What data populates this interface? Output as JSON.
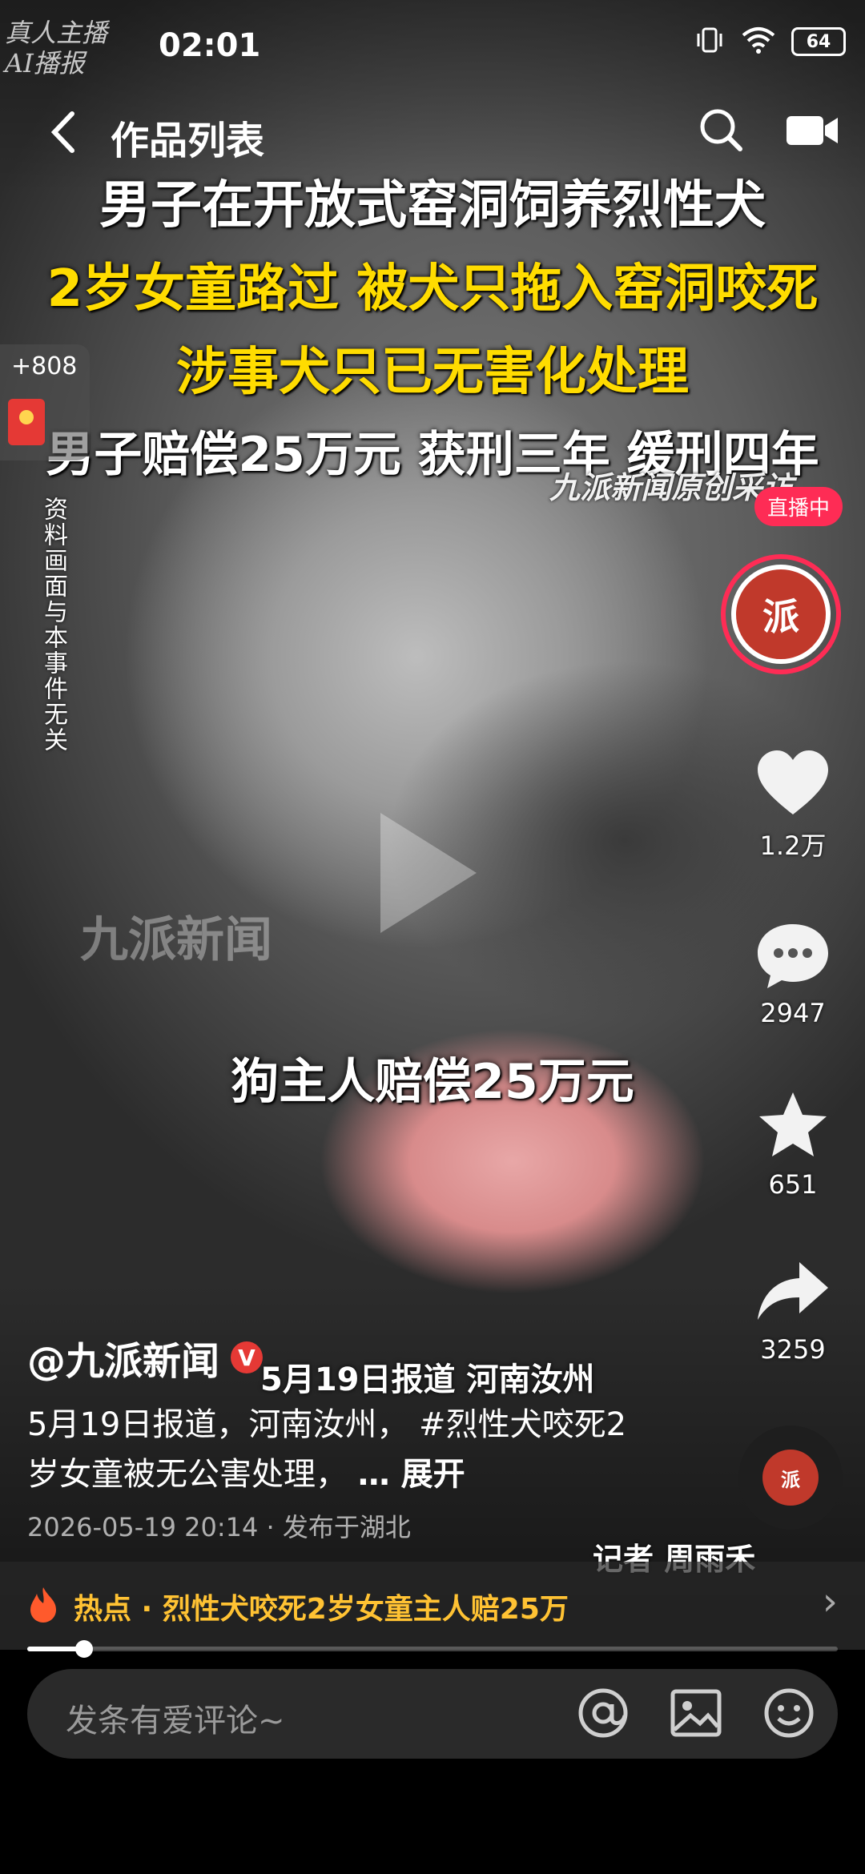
{
  "status_bar": {
    "time": "02:01",
    "ai_badge": "真人主播\nAI播报",
    "battery": "64"
  },
  "header": {
    "title": "作品列表"
  },
  "video": {
    "headline_1": "男子在开放式窑洞饲养烈性犬",
    "headline_2": "2岁女童路过 被犬只拖入窑洞咬死",
    "headline_3": "涉事犬只已无害化处理",
    "headline_4": "男子赔偿25万元  获刑三年 缓刑四年",
    "source": "九派新闻原创采访",
    "side_notice": "资料画面与本事件无关",
    "watermark": "九派新闻",
    "caption": "狗主人赔偿25万元",
    "report_tag": "5月19日报道 河南汝州",
    "reporter": "记者 周雨禾"
  },
  "red_packet": {
    "count": "+808"
  },
  "right_rail": {
    "live_tag": "直播中",
    "likes": "1.2万",
    "comments": "2947",
    "favorites": "651",
    "shares": "3259"
  },
  "post": {
    "author": "@九派新闻",
    "description": "5月19日报道，河南汝州， #烈性犬咬死2岁女童被无公害处理，",
    "expand": "… 展开",
    "meta": "2026-05-19 20:14 · 发布于湖北"
  },
  "hot_topic": {
    "label": "热点 · 烈性犬咬死2岁女童主人赔25万"
  },
  "playback": {
    "progress_fraction": 0.07
  },
  "comment_bar": {
    "placeholder": "发条有爱评论~"
  },
  "colors": {
    "accent": "#fe2c55",
    "hot": "#ffc233",
    "headline_yellow": "#ffdc00"
  }
}
